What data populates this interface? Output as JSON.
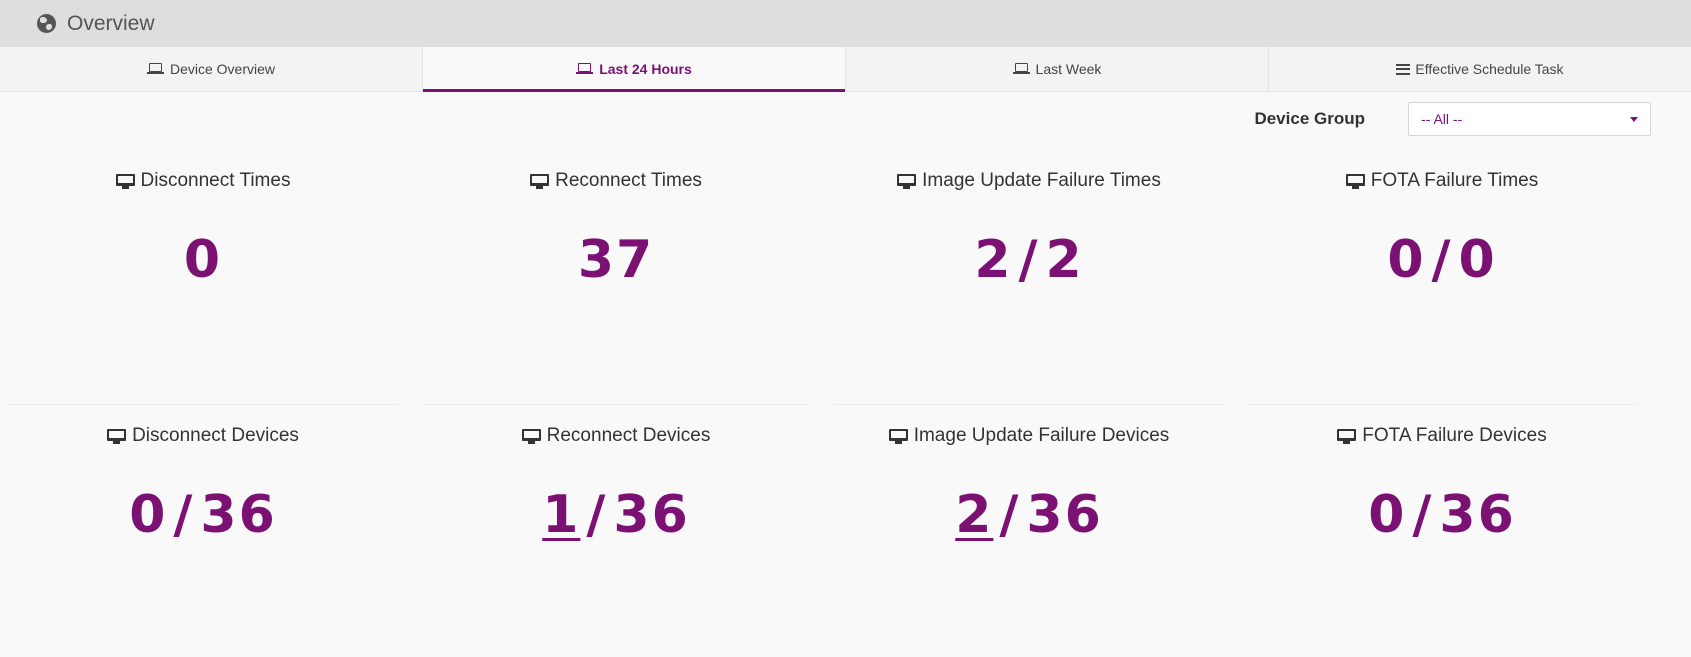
{
  "header": {
    "title": "Overview",
    "icon": "globe-icon"
  },
  "tabs": [
    {
      "label": "Device Overview",
      "icon": "laptop-icon",
      "active": false
    },
    {
      "label": "Last 24 Hours",
      "icon": "laptop-icon",
      "active": true
    },
    {
      "label": "Last Week",
      "icon": "laptop-icon",
      "active": false
    },
    {
      "label": "Effective Schedule Task",
      "icon": "list-icon",
      "active": false
    }
  ],
  "filter": {
    "label": "Device Group",
    "selected": "-- All --"
  },
  "stats_times": [
    {
      "title": "Disconnect Times",
      "value": "0"
    },
    {
      "title": "Reconnect Times",
      "value": "37"
    },
    {
      "title": "Image Update Failure Times",
      "left": "2",
      "right": "2"
    },
    {
      "title": "FOTA Failure Times",
      "left": "0",
      "right": "0"
    }
  ],
  "stats_devices": [
    {
      "title": "Disconnect Devices",
      "left": "0",
      "right": "36"
    },
    {
      "title": "Reconnect Devices",
      "left": "1",
      "right": "36"
    },
    {
      "title": "Image Update Failure Devices",
      "left": "2",
      "right": "36"
    },
    {
      "title": "FOTA Failure Devices",
      "left": "0",
      "right": "36"
    }
  ],
  "separator": "/",
  "colors": {
    "accent": "#7b1173",
    "header_bg": "#dedede",
    "page_bg": "#f9f9f9"
  }
}
